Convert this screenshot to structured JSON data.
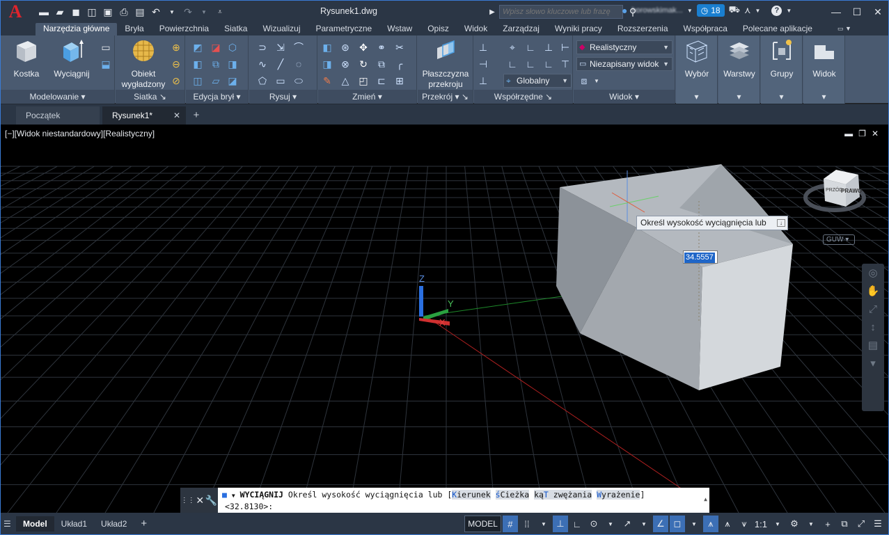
{
  "app": {
    "title": "Rysunek1.dwg",
    "logo_letter": "A",
    "search_placeholder": "Wpisz słowo kluczowe lub frazę",
    "user_name": "borowskimak...",
    "notifications_count": "18",
    "quick_access_icons": [
      "new-icon",
      "open-icon",
      "save-icon",
      "save-as-icon",
      "publish-icon",
      "plot-icon",
      "print-icon",
      "undo-icon",
      "redo-icon"
    ]
  },
  "ribbon_tabs": [
    "Narzędzia główne",
    "Bryła",
    "Powierzchnia",
    "Siatka",
    "Wizualizuj",
    "Parametryczne",
    "Wstaw",
    "Opisz",
    "Widok",
    "Zarządzaj",
    "Wyniki pracy",
    "Rozszerzenia",
    "Współpraca",
    "Polecane aplikacje"
  ],
  "active_ribbon_tab": "Narzędzia główne",
  "ribbon": {
    "modelowanie": {
      "label": "Modelowanie",
      "kostka": "Kostka",
      "wyciagnij": "Wyciągnij"
    },
    "siatka": {
      "label": "Siatka",
      "obiekt_line1": "Obiekt",
      "obiekt_line2": "wygładzony"
    },
    "edycja": {
      "label": "Edycja brył"
    },
    "rysuj": {
      "label": "Rysuj"
    },
    "zmien": {
      "label": "Zmień"
    },
    "przekroj": {
      "label": "Przekrój",
      "plaszczyzna_line1": "Płaszczyzna",
      "plaszczyzna_line2": "przekroju"
    },
    "wspolrzedne": {
      "label": "Współrzędne",
      "ucs_value": "Globalny"
    },
    "widok": {
      "label": "Widok",
      "visual_style": "Realistyczny",
      "named_view": "Niezapisany widok"
    },
    "wybor": {
      "label": "Wybór"
    },
    "warstwy": {
      "label": "Warstwy"
    },
    "grupy": {
      "label": "Grupy"
    },
    "widok2": {
      "label": "Widok"
    }
  },
  "doc_tabs": [
    "Początek",
    "Rysunek1*"
  ],
  "viewport": {
    "label": "[−][Widok niestandardowy][Realistyczny]",
    "tooltip": "Określ wysokość wyciągnięcia lub",
    "dynamic_input_value": "34.5557",
    "viewcube_face": "PRAWO",
    "viewcube_front": "PRZÓD",
    "ucs_menu": "GUW",
    "axis_x": "X",
    "axis_y": "Y",
    "axis_z": "Z"
  },
  "command_line": {
    "command": "WYCIĄGNIJ",
    "prompt": "Określ wysokość wyciągnięcia lub [",
    "options": [
      {
        "key": "K",
        "rest": "ierunek"
      },
      {
        "key": "ś",
        "rest": "Cieżka"
      },
      {
        "pre": "ką",
        "key": "T",
        "rest": " zwężania"
      },
      {
        "key": "W",
        "rest": "yrażenie"
      }
    ],
    "close_bracket": "]",
    "second_line": "<32.8130>:"
  },
  "layout_tabs": [
    "Model",
    "Układ1",
    "Układ2"
  ],
  "status_bar": {
    "model_label": "MODEL",
    "scale": "1:1"
  }
}
